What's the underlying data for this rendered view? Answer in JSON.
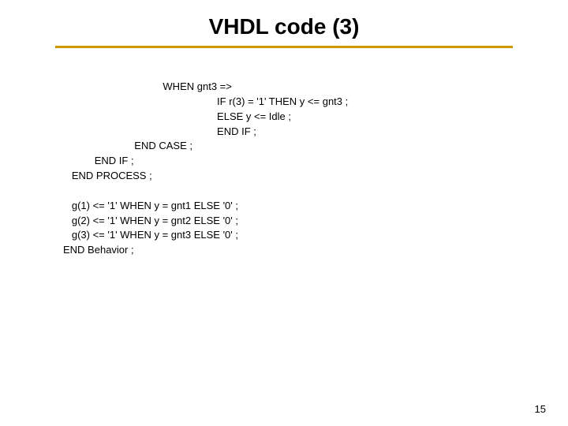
{
  "title": "VHDL code (3)",
  "code": {
    "l1": "                                   WHEN gnt3 =>",
    "l2": "                                                      IF r(3) = '1' THEN y <= gnt3 ;",
    "l3": "                                                      ELSE y <= Idle ;",
    "l4": "                                                      END IF ;",
    "l5": "                         END CASE ;",
    "l6": "           END IF ;",
    "l7": "   END PROCESS ;",
    "l8": "",
    "l9": "   g(1) <= '1' WHEN y = gnt1 ELSE '0' ;",
    "l10": "   g(2) <= '1' WHEN y = gnt2 ELSE '0' ;",
    "l11": "   g(3) <= '1' WHEN y = gnt3 ELSE '0' ;",
    "l12": "END Behavior ;"
  },
  "page_number": "15"
}
